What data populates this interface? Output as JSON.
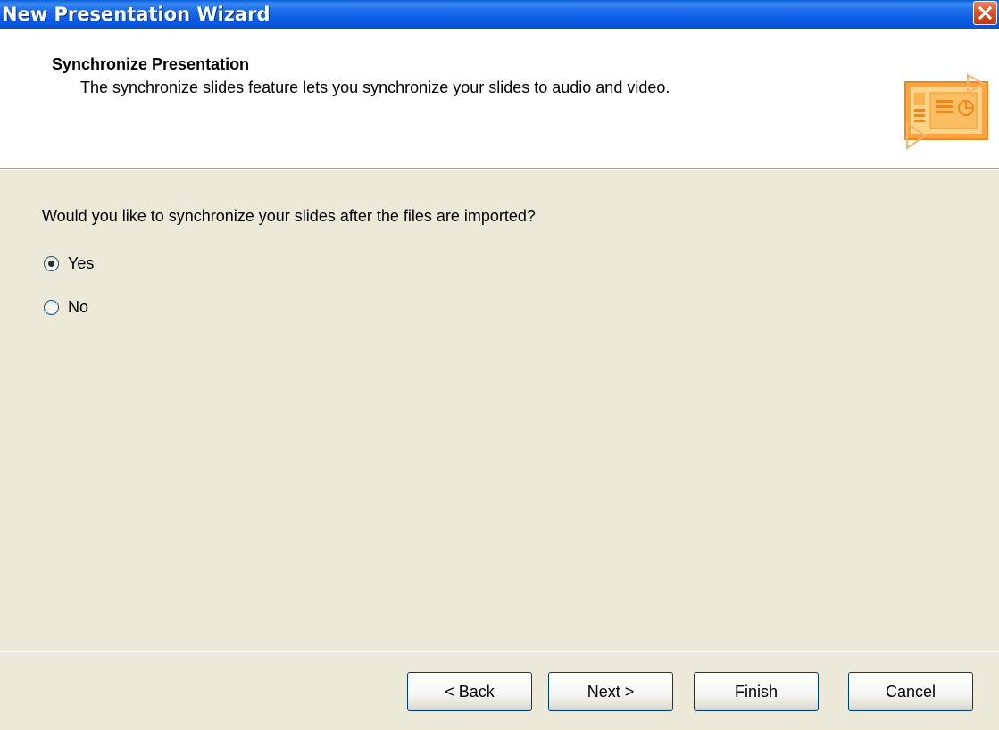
{
  "window": {
    "title": "New Presentation Wizard",
    "close_icon": "close-icon"
  },
  "header": {
    "title": "Synchronize Presentation",
    "subtitle": "The synchronize slides feature lets you synchronize your slides to audio and video.",
    "graphic_icon": "presentation-graphic-icon"
  },
  "question": "Would you like to synchronize your slides after the files are imported?",
  "options": [
    {
      "label": "Yes",
      "selected": true
    },
    {
      "label": "No",
      "selected": false
    }
  ],
  "buttons": {
    "back": "< Back",
    "next": "Next >",
    "finish": "Finish",
    "cancel": "Cancel"
  },
  "colors": {
    "titlebar": "#0b5be6",
    "dialog_background": "#ece9d8",
    "header_background": "#ffffff",
    "graphic_orange": "#f7a23a"
  }
}
